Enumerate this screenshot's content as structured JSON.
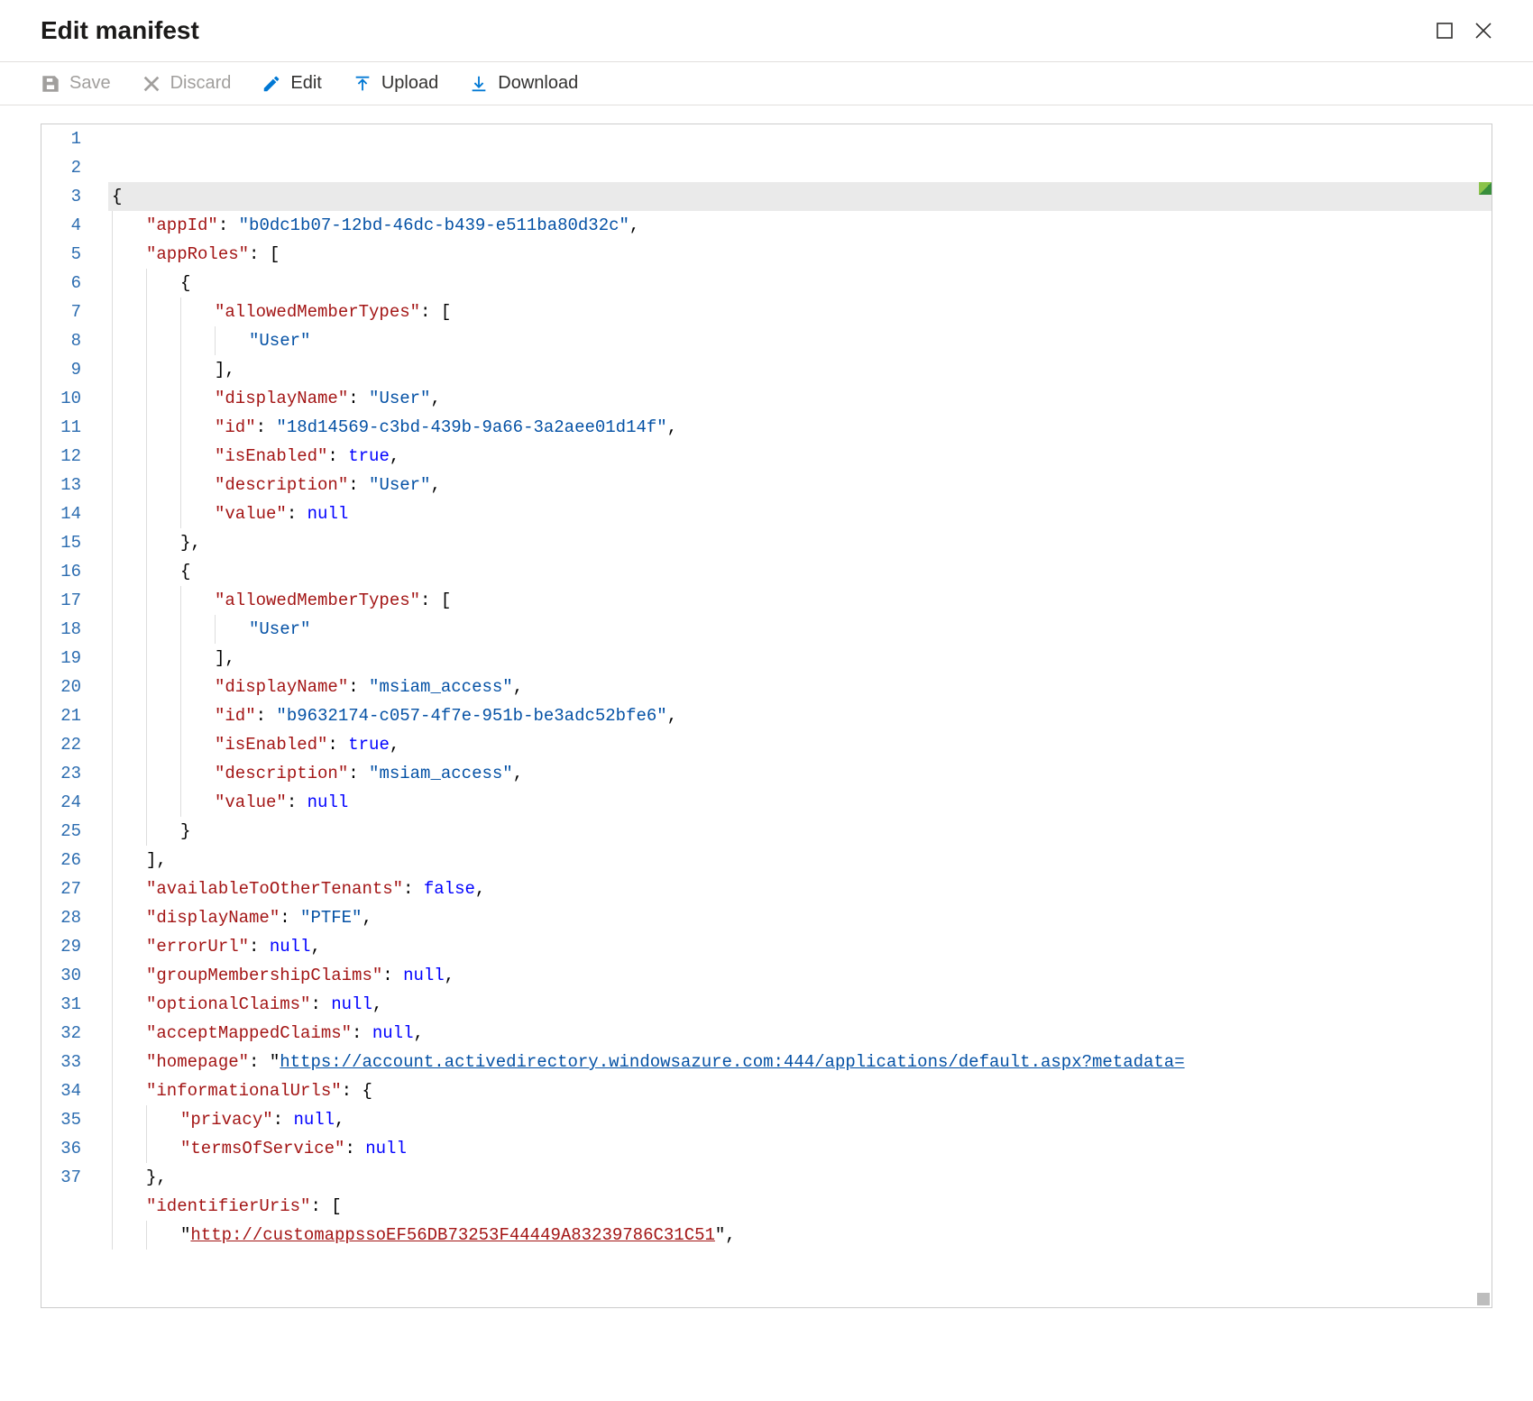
{
  "header": {
    "title": "Edit manifest"
  },
  "toolbar": {
    "save_label": "Save",
    "discard_label": "Discard",
    "edit_label": "Edit",
    "upload_label": "Upload",
    "download_label": "Download"
  },
  "manifest": {
    "appId": "b0dc1b07-12bd-46dc-b439-e511ba80d32c",
    "appRoles": [
      {
        "allowedMemberTypes": [
          "User"
        ],
        "displayName": "User",
        "id": "18d14569-c3bd-439b-9a66-3a2aee01d14f",
        "isEnabled": true,
        "description": "User",
        "value": null
      },
      {
        "allowedMemberTypes": [
          "User"
        ],
        "displayName": "msiam_access",
        "id": "b9632174-c057-4f7e-951b-be3adc52bfe6",
        "isEnabled": true,
        "description": "msiam_access",
        "value": null
      }
    ],
    "availableToOtherTenants": false,
    "displayName": "PTFE",
    "errorUrl": null,
    "groupMembershipClaims": null,
    "optionalClaims": null,
    "acceptMappedClaims": null,
    "homepage": "https://account.activedirectory.windowsazure.com:444/applications/default.aspx?metadata=",
    "informationalUrls": {
      "privacy": null,
      "termsOfService": null
    },
    "identifierUris": [
      "http://customappssoEF56DB73253F44449A83239786C31C51"
    ]
  },
  "editor": {
    "visible_lines": 37,
    "lines": [
      [
        [
          "punc",
          "{"
        ]
      ],
      [
        [
          "indent",
          1
        ],
        [
          "key",
          "\"appId\""
        ],
        [
          "punc",
          ": "
        ],
        [
          "str",
          "\"b0dc1b07-12bd-46dc-b439-e511ba80d32c\""
        ],
        [
          "punc",
          ","
        ]
      ],
      [
        [
          "indent",
          1
        ],
        [
          "key",
          "\"appRoles\""
        ],
        [
          "punc",
          ": ["
        ]
      ],
      [
        [
          "indent",
          2
        ],
        [
          "punc",
          "{"
        ]
      ],
      [
        [
          "indent",
          3
        ],
        [
          "key",
          "\"allowedMemberTypes\""
        ],
        [
          "punc",
          ": ["
        ]
      ],
      [
        [
          "indent",
          4
        ],
        [
          "str",
          "\"User\""
        ]
      ],
      [
        [
          "indent",
          3
        ],
        [
          "punc",
          "],"
        ]
      ],
      [
        [
          "indent",
          3
        ],
        [
          "key",
          "\"displayName\""
        ],
        [
          "punc",
          ": "
        ],
        [
          "str",
          "\"User\""
        ],
        [
          "punc",
          ","
        ]
      ],
      [
        [
          "indent",
          3
        ],
        [
          "key",
          "\"id\""
        ],
        [
          "punc",
          ": "
        ],
        [
          "str",
          "\"18d14569-c3bd-439b-9a66-3a2aee01d14f\""
        ],
        [
          "punc",
          ","
        ]
      ],
      [
        [
          "indent",
          3
        ],
        [
          "key",
          "\"isEnabled\""
        ],
        [
          "punc",
          ": "
        ],
        [
          "bool",
          "true"
        ],
        [
          "punc",
          ","
        ]
      ],
      [
        [
          "indent",
          3
        ],
        [
          "key",
          "\"description\""
        ],
        [
          "punc",
          ": "
        ],
        [
          "str",
          "\"User\""
        ],
        [
          "punc",
          ","
        ]
      ],
      [
        [
          "indent",
          3
        ],
        [
          "key",
          "\"value\""
        ],
        [
          "punc",
          ": "
        ],
        [
          "null",
          "null"
        ]
      ],
      [
        [
          "indent",
          2
        ],
        [
          "punc",
          "},"
        ]
      ],
      [
        [
          "indent",
          2
        ],
        [
          "punc",
          "{"
        ]
      ],
      [
        [
          "indent",
          3
        ],
        [
          "key",
          "\"allowedMemberTypes\""
        ],
        [
          "punc",
          ": ["
        ]
      ],
      [
        [
          "indent",
          4
        ],
        [
          "str",
          "\"User\""
        ]
      ],
      [
        [
          "indent",
          3
        ],
        [
          "punc",
          "],"
        ]
      ],
      [
        [
          "indent",
          3
        ],
        [
          "key",
          "\"displayName\""
        ],
        [
          "punc",
          ": "
        ],
        [
          "str",
          "\"msiam_access\""
        ],
        [
          "punc",
          ","
        ]
      ],
      [
        [
          "indent",
          3
        ],
        [
          "key",
          "\"id\""
        ],
        [
          "punc",
          ": "
        ],
        [
          "str",
          "\"b9632174-c057-4f7e-951b-be3adc52bfe6\""
        ],
        [
          "punc",
          ","
        ]
      ],
      [
        [
          "indent",
          3
        ],
        [
          "key",
          "\"isEnabled\""
        ],
        [
          "punc",
          ": "
        ],
        [
          "bool",
          "true"
        ],
        [
          "punc",
          ","
        ]
      ],
      [
        [
          "indent",
          3
        ],
        [
          "key",
          "\"description\""
        ],
        [
          "punc",
          ": "
        ],
        [
          "str",
          "\"msiam_access\""
        ],
        [
          "punc",
          ","
        ]
      ],
      [
        [
          "indent",
          3
        ],
        [
          "key",
          "\"value\""
        ],
        [
          "punc",
          ": "
        ],
        [
          "null",
          "null"
        ]
      ],
      [
        [
          "indent",
          2
        ],
        [
          "punc",
          "}"
        ]
      ],
      [
        [
          "indent",
          1
        ],
        [
          "punc",
          "],"
        ]
      ],
      [
        [
          "indent",
          1
        ],
        [
          "key",
          "\"availableToOtherTenants\""
        ],
        [
          "punc",
          ": "
        ],
        [
          "bool",
          "false"
        ],
        [
          "punc",
          ","
        ]
      ],
      [
        [
          "indent",
          1
        ],
        [
          "key",
          "\"displayName\""
        ],
        [
          "punc",
          ": "
        ],
        [
          "str",
          "\"PTFE\""
        ],
        [
          "punc",
          ","
        ]
      ],
      [
        [
          "indent",
          1
        ],
        [
          "key",
          "\"errorUrl\""
        ],
        [
          "punc",
          ": "
        ],
        [
          "null",
          "null"
        ],
        [
          "punc",
          ","
        ]
      ],
      [
        [
          "indent",
          1
        ],
        [
          "key",
          "\"groupMembershipClaims\""
        ],
        [
          "punc",
          ": "
        ],
        [
          "null",
          "null"
        ],
        [
          "punc",
          ","
        ]
      ],
      [
        [
          "indent",
          1
        ],
        [
          "key",
          "\"optionalClaims\""
        ],
        [
          "punc",
          ": "
        ],
        [
          "null",
          "null"
        ],
        [
          "punc",
          ","
        ]
      ],
      [
        [
          "indent",
          1
        ],
        [
          "key",
          "\"acceptMappedClaims\""
        ],
        [
          "punc",
          ": "
        ],
        [
          "null",
          "null"
        ],
        [
          "punc",
          ","
        ]
      ],
      [
        [
          "indent",
          1
        ],
        [
          "key",
          "\"homepage\""
        ],
        [
          "punc",
          ": "
        ],
        [
          "punc",
          "\""
        ],
        [
          "url",
          "https://account.activedirectory.windowsazure.com:444/applications/default.aspx?metadata="
        ]
      ],
      [
        [
          "indent",
          1
        ],
        [
          "key",
          "\"informationalUrls\""
        ],
        [
          "punc",
          ": {"
        ]
      ],
      [
        [
          "indent",
          2
        ],
        [
          "key",
          "\"privacy\""
        ],
        [
          "punc",
          ": "
        ],
        [
          "null",
          "null"
        ],
        [
          "punc",
          ","
        ]
      ],
      [
        [
          "indent",
          2
        ],
        [
          "key",
          "\"termsOfService\""
        ],
        [
          "punc",
          ": "
        ],
        [
          "null",
          "null"
        ]
      ],
      [
        [
          "indent",
          1
        ],
        [
          "punc",
          "},"
        ]
      ],
      [
        [
          "indent",
          1
        ],
        [
          "key",
          "\"identifierUris\""
        ],
        [
          "punc",
          ": ["
        ]
      ],
      [
        [
          "indent",
          2
        ],
        [
          "punc",
          "\""
        ],
        [
          "strlnk",
          "http://customappssoEF56DB73253F44449A83239786C31C51"
        ],
        [
          "punc",
          "\","
        ]
      ]
    ]
  }
}
